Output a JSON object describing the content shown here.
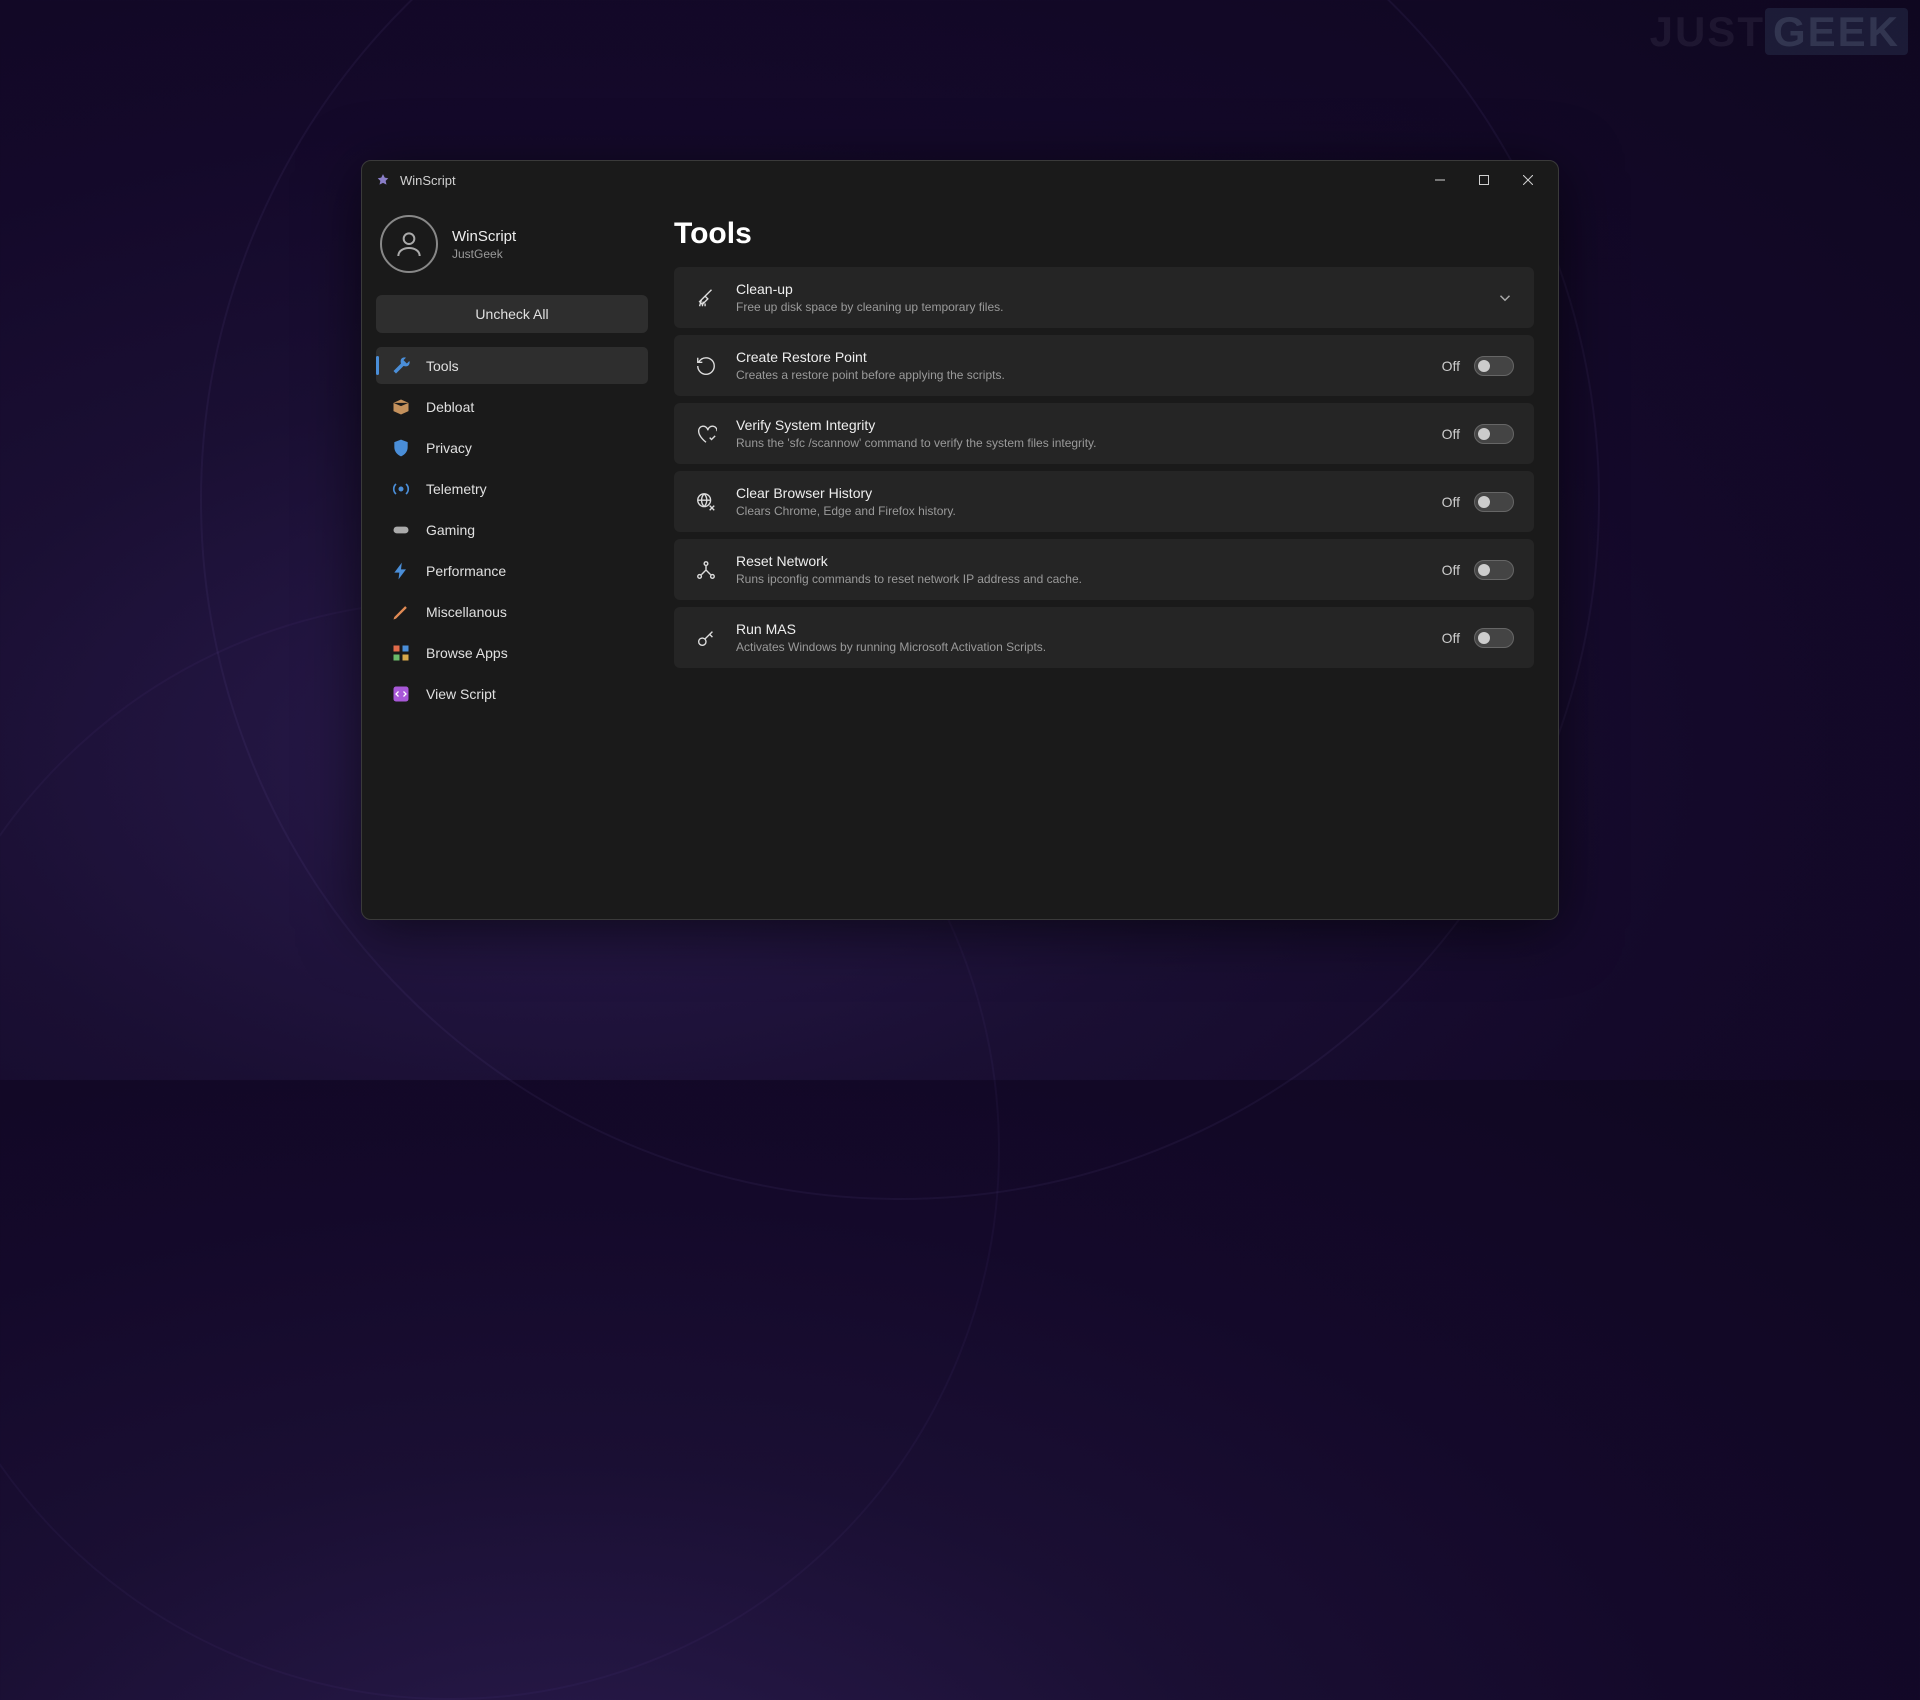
{
  "watermark": {
    "just": "JUST",
    "geek": "GEEK"
  },
  "window": {
    "title": "WinScript"
  },
  "profile": {
    "name": "WinScript",
    "sub": "JustGeek"
  },
  "uncheck_label": "Uncheck All",
  "sidebar": {
    "items": [
      {
        "label": "Tools",
        "active": true
      },
      {
        "label": "Debloat"
      },
      {
        "label": "Privacy"
      },
      {
        "label": "Telemetry"
      },
      {
        "label": "Gaming"
      },
      {
        "label": "Performance"
      },
      {
        "label": "Miscellanous"
      },
      {
        "label": "Browse Apps"
      },
      {
        "label": "View Script"
      }
    ]
  },
  "page": {
    "title": "Tools"
  },
  "cards": [
    {
      "title": "Clean-up",
      "desc": "Free up disk space by cleaning up temporary files.",
      "type": "expand"
    },
    {
      "title": "Create Restore Point",
      "desc": "Creates a restore point before applying the scripts.",
      "type": "toggle",
      "state": "Off"
    },
    {
      "title": "Verify System Integrity",
      "desc": "Runs the 'sfc /scannow' command to verify the system files integrity.",
      "type": "toggle",
      "state": "Off"
    },
    {
      "title": "Clear Browser History",
      "desc": "Clears Chrome, Edge and Firefox history.",
      "type": "toggle",
      "state": "Off"
    },
    {
      "title": "Reset Network",
      "desc": "Runs ipconfig commands to reset network IP address and cache.",
      "type": "toggle",
      "state": "Off"
    },
    {
      "title": "Run MAS",
      "desc": "Activates Windows by running Microsoft Activation Scripts.",
      "type": "toggle",
      "state": "Off"
    }
  ]
}
